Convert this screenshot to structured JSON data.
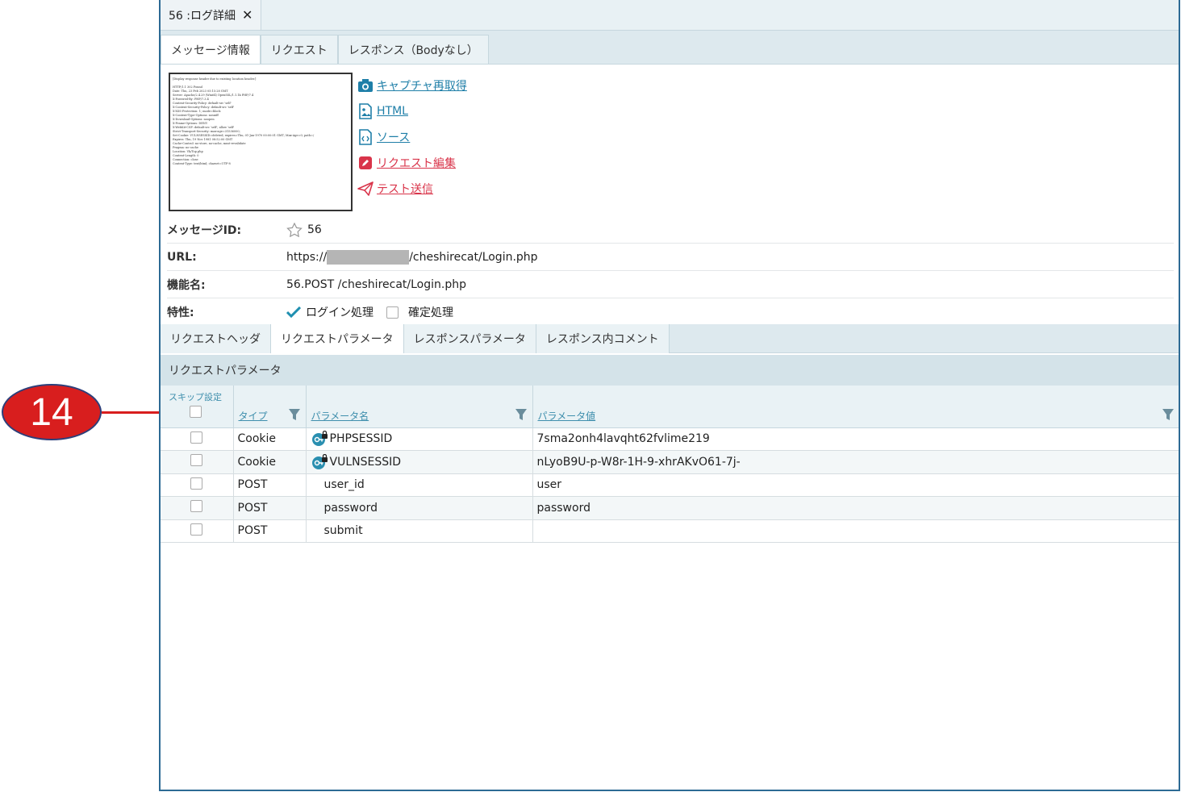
{
  "callout": {
    "number": "14"
  },
  "doc_tab": {
    "title": "56 :ログ詳細",
    "close": "✕"
  },
  "sub_tabs": [
    "メッセージ情報",
    "リクエスト",
    "レスポンス（Bodyなし）"
  ],
  "actions": [
    {
      "label": "キャプチャ再取得",
      "icon": "camera-icon",
      "color": "#1f7fa8"
    },
    {
      "label": "HTML",
      "icon": "image-file-icon",
      "color": "#1f7fa8"
    },
    {
      "label": "ソース",
      "icon": "code-file-icon",
      "color": "#1f7fa8"
    },
    {
      "label": "リクエスト編集",
      "icon": "edit-icon",
      "color": "#d9344a"
    },
    {
      "label": "テスト送信",
      "icon": "send-icon",
      "color": "#d9344a"
    }
  ],
  "info": {
    "message_id_label": "メッセージID:",
    "message_id": "56",
    "url_label": "URL:",
    "url_prefix": "https://",
    "url_suffix": "/cheshirecat/Login.php",
    "function_label": "機能名:",
    "function_name": "56.POST /cheshirecat/Login.php",
    "trait_label": "特性:",
    "trait_login": "ログイン処理",
    "trait_confirm": "確定処理"
  },
  "detail_tabs": [
    "リクエストヘッダ",
    "リクエストパラメータ",
    "レスポンスパラメータ",
    "レスポンス内コメント"
  ],
  "section_title": "リクエストパラメータ",
  "table": {
    "skip_header": "スキップ設定",
    "col_type": "タイプ",
    "col_name": "パラメータ名",
    "col_value": "パラメータ値",
    "rows": [
      {
        "type": "Cookie",
        "name": "PHPSESSID",
        "value": "7sma2onh4lavqht62fvlime219"
      },
      {
        "type": "Cookie",
        "name": "VULNSESSID",
        "value": "nLyoB9U-p-W8r-1H-9-xhrAKvO61-7j-"
      },
      {
        "type": "POST",
        "name": "user_id",
        "value": "user"
      },
      {
        "type": "POST",
        "name": "password",
        "value": "password"
      },
      {
        "type": "POST",
        "name": "submit",
        "value": ""
      }
    ]
  }
}
